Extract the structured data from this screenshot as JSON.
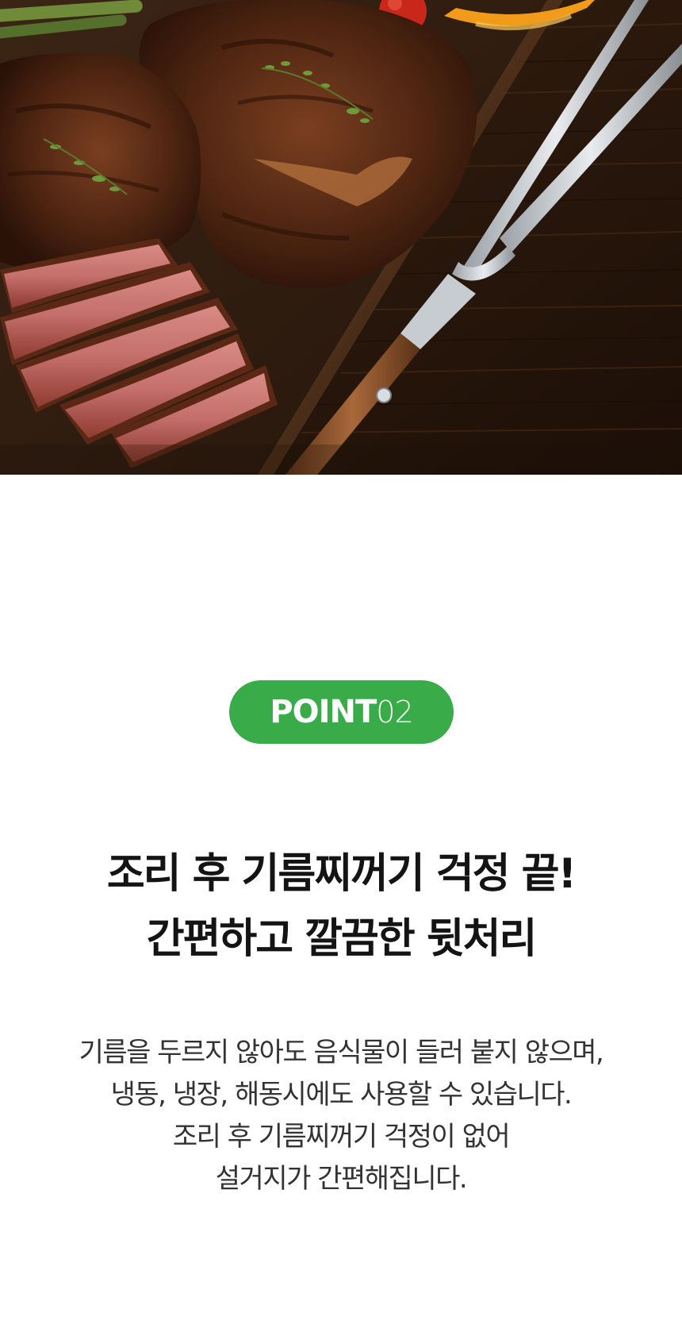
{
  "badge": {
    "word": "POINT",
    "number": "02",
    "color": "#3aab49"
  },
  "headline": {
    "line1": "조리 후 기름찌꺼기 걱정 끝!",
    "line2": "간편하고 깔끔한 뒷처리"
  },
  "description": {
    "lines": [
      "기름을 두르지 않아도 음식물이 들러 붙지 않으며,",
      "냉동, 냉장, 해동시에도 사용할 수 있습니다.",
      "조리 후 기름찌꺼기 걱정이 없어",
      "설거지가 간편해집니다."
    ]
  },
  "hero_image": {
    "subject": "grilled-steak-on-cutting-board-with-fork"
  }
}
